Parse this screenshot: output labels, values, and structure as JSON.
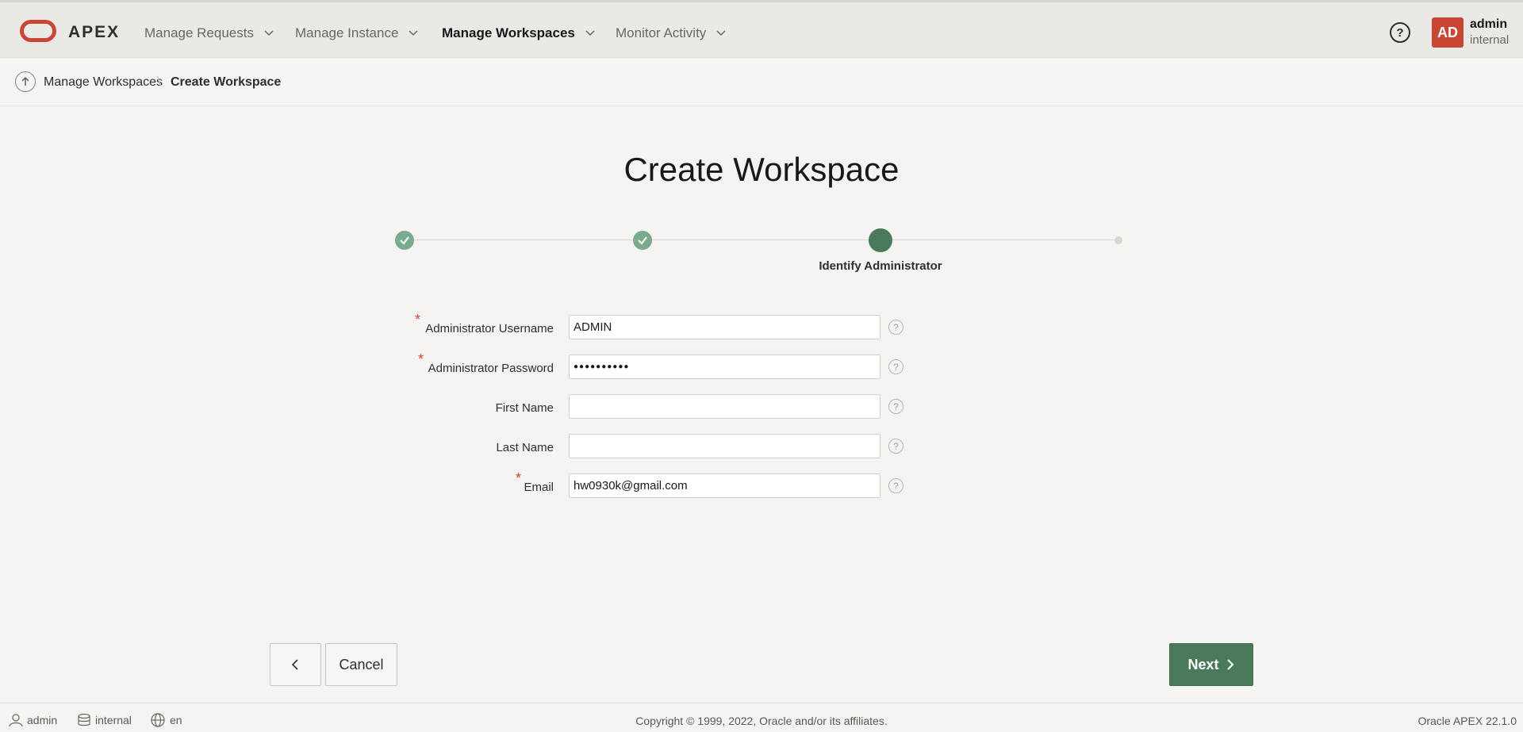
{
  "app": {
    "logo_text": "APEX"
  },
  "nav": {
    "items": [
      {
        "label": "Manage Requests"
      },
      {
        "label": "Manage Instance"
      },
      {
        "label": "Manage Workspaces"
      },
      {
        "label": "Monitor Activity"
      }
    ],
    "active": "Manage Workspaces"
  },
  "user": {
    "initials": "AD",
    "name": "admin",
    "workspace": "internal",
    "help_glyph": "?"
  },
  "breadcrumb": {
    "parent": "Manage Workspaces",
    "current": "Create Workspace"
  },
  "page": {
    "title": "Create Workspace"
  },
  "wizard": {
    "steps": [
      {
        "status": "complete"
      },
      {
        "status": "complete"
      },
      {
        "status": "current",
        "label": "Identify Administrator"
      },
      {
        "status": "pending"
      }
    ]
  },
  "form": {
    "fields": [
      {
        "label": "Administrator Username",
        "required": true,
        "value": "ADMIN",
        "type": "text"
      },
      {
        "label": "Administrator Password",
        "required": true,
        "value": "●●●●●●●●●●",
        "type": "password"
      },
      {
        "label": "First Name",
        "required": false,
        "value": "",
        "type": "text"
      },
      {
        "label": "Last Name",
        "required": false,
        "value": "",
        "type": "text"
      },
      {
        "label": "Email",
        "required": true,
        "value": "hw0930k@gmail.com",
        "type": "text"
      }
    ],
    "required_marker": "*",
    "help_glyph": "?"
  },
  "buttons": {
    "previous_icon": "chevron-left-icon",
    "cancel": "Cancel",
    "next": "Next"
  },
  "footer": {
    "user": "admin",
    "workspace": "internal",
    "language": "en",
    "copyright": "Copyright © 1999, 2022, Oracle and/or its affiliates.",
    "version": "Oracle APEX 22.1.0"
  },
  "colors": {
    "brand": "#c74634",
    "accent_green": "#4b7a5a",
    "step_done": "#7aab8e"
  }
}
